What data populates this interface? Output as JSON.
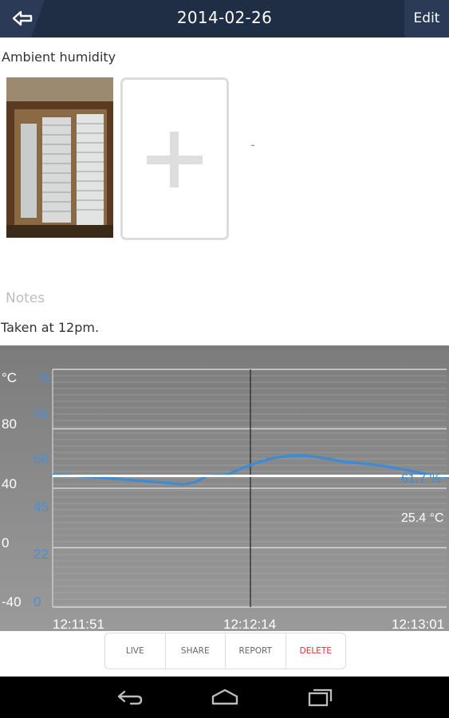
{
  "header": {
    "title": "2014-02-26",
    "edit_label": "Edit",
    "back_icon": "back-arrow-icon"
  },
  "measurement": {
    "type_label": "Ambient humidity",
    "dash": "-"
  },
  "notes": {
    "placeholder": "Notes",
    "text": "Taken at 12pm."
  },
  "chart_data": {
    "type": "line",
    "x_ticks": [
      "12:11:51",
      "12:12:14",
      "12:13:01"
    ],
    "y_left": {
      "unit": "°C",
      "ticks": [
        80,
        40,
        0,
        -40
      ],
      "color": "#ffffff"
    },
    "y_right": {
      "unit": "%",
      "ticks": [
        91,
        68,
        45,
        22,
        0
      ],
      "color": "#4a8fd0"
    },
    "series": [
      {
        "unit": "%",
        "color": "#3d8bd4",
        "values": [
          [
            0,
            62
          ],
          [
            0.1,
            61
          ],
          [
            0.2,
            59.5
          ],
          [
            0.3,
            58
          ],
          [
            0.33,
            57.5
          ],
          [
            0.36,
            58.5
          ],
          [
            0.39,
            61.5
          ],
          [
            0.44,
            62
          ],
          [
            0.47,
            64.5
          ],
          [
            0.52,
            68
          ],
          [
            0.56,
            70
          ],
          [
            0.6,
            71
          ],
          [
            0.64,
            71
          ],
          [
            0.68,
            70
          ],
          [
            0.74,
            68
          ],
          [
            0.8,
            67
          ],
          [
            0.84,
            66
          ],
          [
            0.9,
            64
          ],
          [
            0.95,
            62
          ],
          [
            1.0,
            61
          ]
        ],
        "end_label": "61.7 %"
      },
      {
        "unit": "°C",
        "color": "#ffffff",
        "values": [
          [
            0,
            25.4
          ],
          [
            1,
            25.4
          ]
        ],
        "end_label": "25.4 °C"
      }
    ]
  },
  "actions": {
    "live": "LIVE",
    "share": "SHARE",
    "report": "REPORT",
    "delete": "DELETE"
  },
  "colors": {
    "header_bg": "#1f2d45",
    "accent_blue": "#3d8bd4",
    "delete_red": "#e03030"
  }
}
